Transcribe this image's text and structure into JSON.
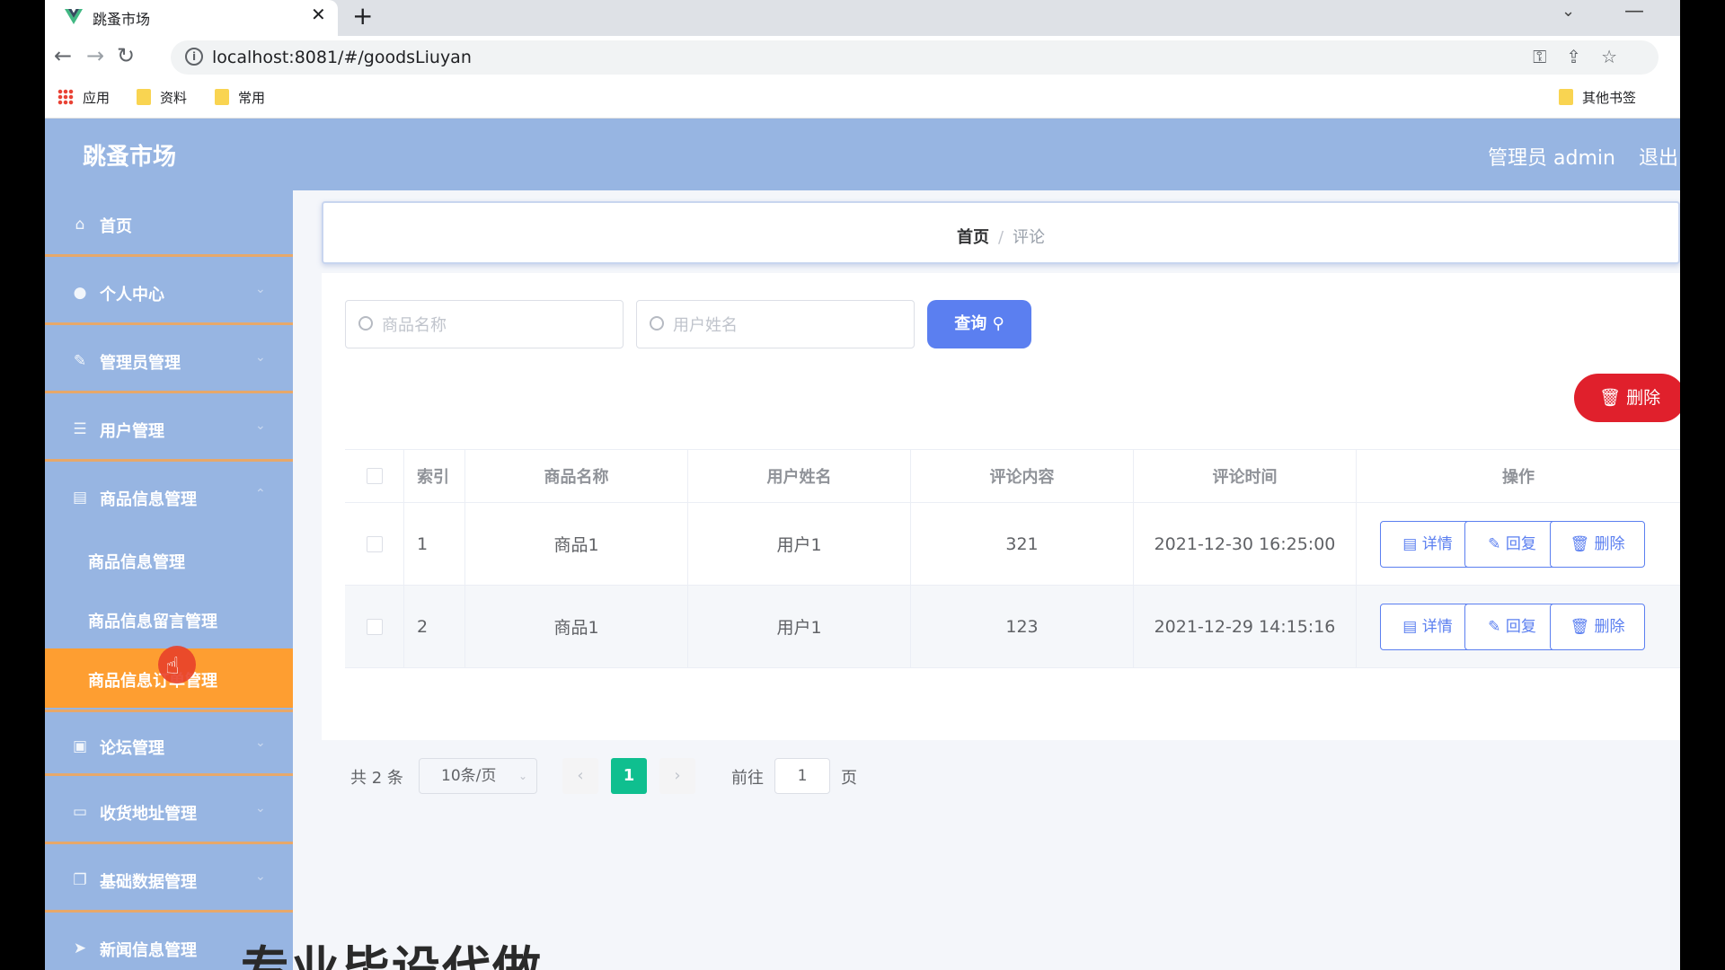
{
  "browser": {
    "tab_title": "跳蚤市场",
    "url": "localhost:8081/#/goodsLiuyan",
    "bookmarks": [
      {
        "label": "应用",
        "icon": "apps-grid-icon"
      },
      {
        "label": "资料",
        "icon": "folder-icon"
      },
      {
        "label": "常用",
        "icon": "folder-icon"
      }
    ],
    "other_bookmarks": "其他书签"
  },
  "header": {
    "title": "跳蚤市场",
    "user": "管理员 admin",
    "logout": "退出"
  },
  "sidebar": {
    "items": [
      {
        "label": "首页",
        "icon": "home-icon"
      },
      {
        "label": "个人中心",
        "icon": "user-icon"
      },
      {
        "label": "管理员管理",
        "icon": "admin-icon"
      },
      {
        "label": "用户管理",
        "icon": "list-icon"
      },
      {
        "label": "商品信息管理",
        "icon": "clipboard-icon"
      }
    ],
    "sub_items": [
      {
        "label": "商品信息管理"
      },
      {
        "label": "商品信息留言管理"
      },
      {
        "label": "商品信息订单管理"
      }
    ],
    "items_after": [
      {
        "label": "论坛管理",
        "icon": "forum-icon"
      },
      {
        "label": "收货地址管理",
        "icon": "address-icon"
      },
      {
        "label": "基础数据管理",
        "icon": "data-icon"
      },
      {
        "label": "新闻信息管理",
        "icon": "send-icon"
      }
    ]
  },
  "breadcrumb": {
    "home": "首页",
    "separator": "/",
    "current": "评论"
  },
  "search": {
    "goods_placeholder": "商品名称",
    "user_placeholder": "用户姓名",
    "query_label": "查询"
  },
  "toolbar": {
    "delete_label": "删除"
  },
  "table": {
    "columns": [
      "索引",
      "商品名称",
      "用户姓名",
      "评论内容",
      "评论时间",
      "操作"
    ],
    "rows": [
      {
        "index": "1",
        "goods": "商品1",
        "user": "用户1",
        "content": "321",
        "time": "2021-12-30 16:25:00"
      },
      {
        "index": "2",
        "goods": "商品1",
        "user": "用户1",
        "content": "123",
        "time": "2021-12-29 14:15:16"
      }
    ],
    "actions": {
      "detail": "详情",
      "reply": "回复",
      "delete": "删除"
    }
  },
  "pagination": {
    "total": "共 2 条",
    "page_size": "10条/页",
    "current_page": "1",
    "goto_label": "前往",
    "goto_value": "1",
    "page_suffix": "页"
  },
  "overlay_text": "专业毕设代做",
  "colors": {
    "header_bg": "#97b5e2",
    "active_menu": "#fe9e31",
    "primary": "#5b7ff0",
    "danger": "#e0202c",
    "pager_active": "#0fbf8f"
  }
}
